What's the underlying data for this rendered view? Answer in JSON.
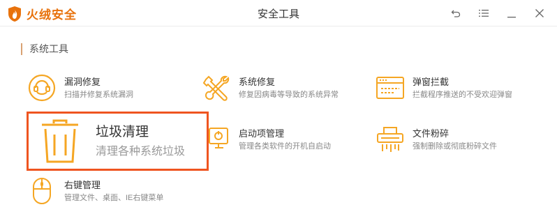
{
  "app": {
    "name": "火绒安全",
    "window_title": "安全工具"
  },
  "section": {
    "label": "系统工具"
  },
  "tools": {
    "vuln_fix": {
      "name": "漏洞修复",
      "desc": "扫描并修复系统漏洞",
      "icon": "shield-target-icon"
    },
    "sys_repair": {
      "name": "系统修复",
      "desc": "修复因病毒等导致的系统异常",
      "icon": "wrench-screwdriver-icon"
    },
    "popup_block": {
      "name": "弹窗拦截",
      "desc": "拦截程序推送的不受欢迎弹窗",
      "icon": "popup-window-icon"
    },
    "junk_clean": {
      "name": "垃圾清理",
      "desc": "清理各种系统垃圾",
      "icon": "trash-icon",
      "highlighted": true
    },
    "startup_mgr": {
      "name": "启动项管理",
      "desc": "管理各类软件的开机自启动",
      "icon": "monitor-icon"
    },
    "file_shred": {
      "name": "文件粉碎",
      "desc": "强制删除或彻底粉碎文件",
      "icon": "shredder-icon"
    },
    "context_menu": {
      "name": "右键管理",
      "desc": "管理文件、桌面、IE右键菜单",
      "icon": "mouse-icon"
    }
  },
  "colors": {
    "accent": "#f5a623",
    "brand": "#e8720c",
    "highlight_border": "#ef5520"
  }
}
